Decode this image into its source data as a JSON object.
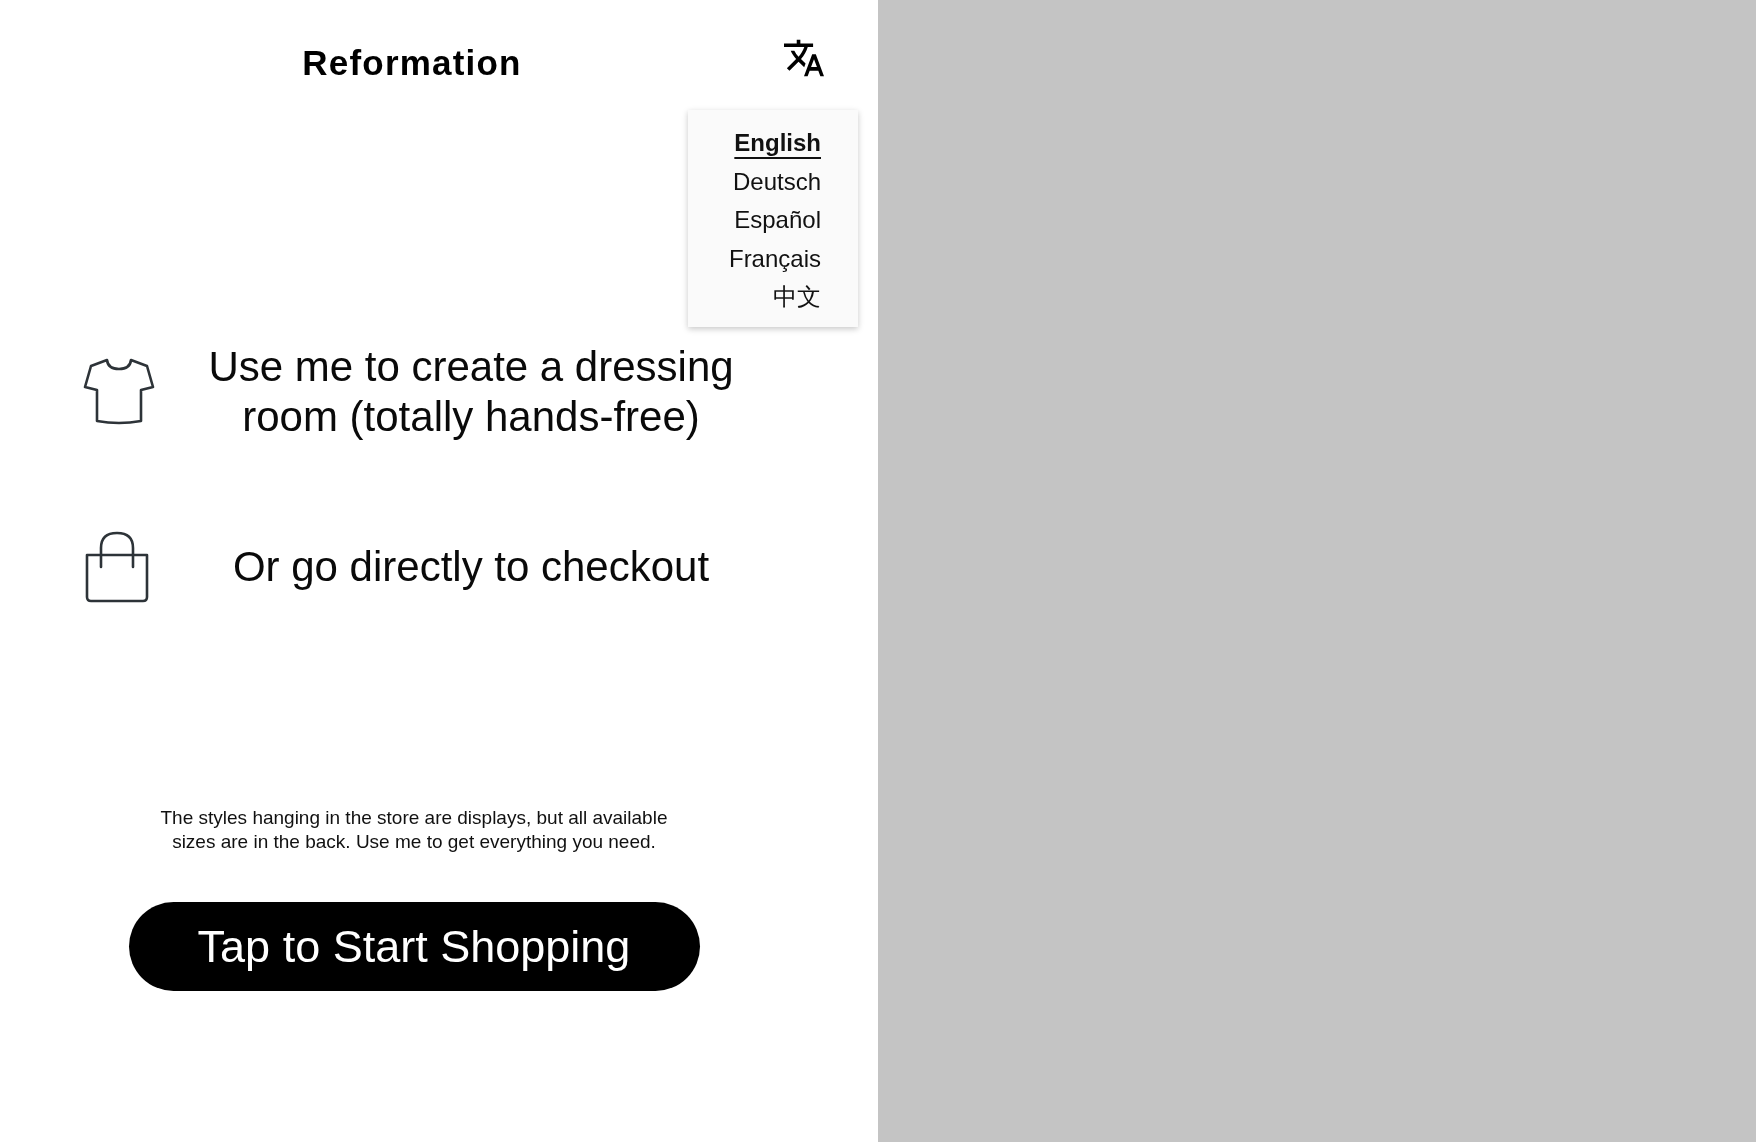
{
  "header": {
    "logo": "Reformation"
  },
  "language_button": {
    "expanded": true
  },
  "language_menu": {
    "items": [
      {
        "label": "English",
        "selected": true
      },
      {
        "label": "Deutsch",
        "selected": false
      },
      {
        "label": "Español",
        "selected": false
      },
      {
        "label": "Français",
        "selected": false
      },
      {
        "label": "中文",
        "selected": false
      }
    ]
  },
  "features": [
    {
      "kind": "shirt",
      "text": "Use me to create a dressing room (totally hands-free)"
    },
    {
      "kind": "bag",
      "text": "Or go directly to checkout"
    }
  ],
  "note": "The styles hanging in the store are displays, but all available sizes are in the back. Use me to get everything you need.",
  "start_button": {
    "label": "Tap to Start Shopping"
  }
}
